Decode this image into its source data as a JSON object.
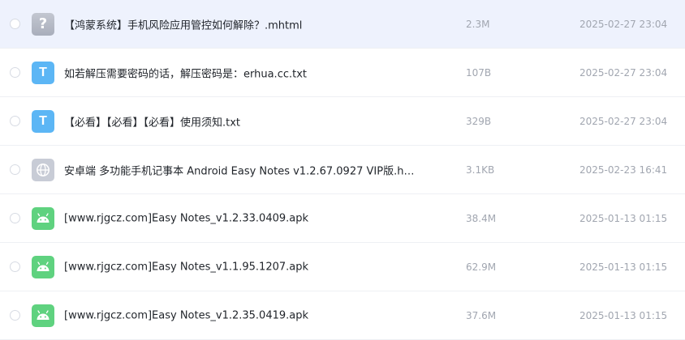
{
  "files": [
    {
      "icon": "unknown-file-icon",
      "icon_glyph": "?",
      "name": "【鸿蒙系统】手机风险应用管控如何解除？.mhtml",
      "size": "2.3M",
      "date": "2025-02-27 23:04"
    },
    {
      "icon": "text-file-icon",
      "icon_glyph": "T",
      "name": "如若解压需要密码的话，解压密码是：erhua.cc.txt",
      "size": "107B",
      "date": "2025-02-27 23:04"
    },
    {
      "icon": "text-file-icon",
      "icon_glyph": "T",
      "name": "【必看】【必看】【必看】使用须知.txt",
      "size": "329B",
      "date": "2025-02-27 23:04"
    },
    {
      "icon": "web-file-icon",
      "name": "安卓端 多功能手机记事本 Android Easy Notes v1.2.67.0927 VIP版.h…",
      "size": "3.1KB",
      "date": "2025-02-23 16:41"
    },
    {
      "icon": "android-apk-icon",
      "name": "[www.rjgcz.com]Easy Notes_v1.2.33.0409.apk",
      "size": "38.4M",
      "date": "2025-01-13 01:15"
    },
    {
      "icon": "android-apk-icon",
      "name": "[www.rjgcz.com]Easy Notes_v1.1.95.1207.apk",
      "size": "62.9M",
      "date": "2025-01-13 01:15"
    },
    {
      "icon": "android-apk-icon",
      "name": "[www.rjgcz.com]Easy Notes_v1.2.35.0419.apk",
      "size": "37.6M",
      "date": "2025-01-13 01:15"
    }
  ],
  "colors": {
    "selected_row": "#eef2fd",
    "txt_icon": "#5cb6f5",
    "apk_icon": "#5fd27f",
    "meta_text": "#a1a6b0"
  }
}
